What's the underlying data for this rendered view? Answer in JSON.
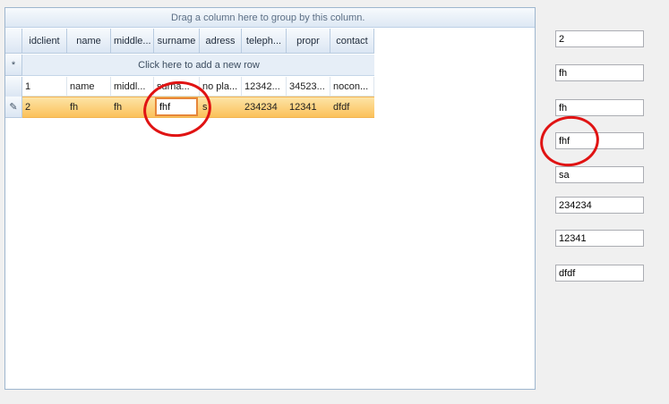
{
  "grid": {
    "group_panel_text": "Drag a column here to group by this column.",
    "columns": [
      "idclient",
      "name",
      "middle...",
      "surname",
      "adress",
      "teleph...",
      "propr",
      "contact"
    ],
    "new_row_text": "Click here to add a new row",
    "new_row_marker": "*",
    "edit_marker": "✎",
    "rows": [
      [
        "1",
        "name",
        "middl...",
        "surna...",
        "no pla...",
        "12342...",
        "34523...",
        "nocon..."
      ],
      [
        "2",
        "fh",
        "fh",
        "fhf",
        "s",
        "234234",
        "12341",
        "dfdf"
      ]
    ],
    "editor_value": "fhf"
  },
  "fields": [
    "2",
    "fh",
    "fh",
    "fhf",
    "sa",
    "234234",
    "12341",
    "dfdf"
  ],
  "colors": {
    "selected_row": "#fbc15a",
    "editor_border": "#e6863a",
    "annotation_circle": "#e01313"
  }
}
